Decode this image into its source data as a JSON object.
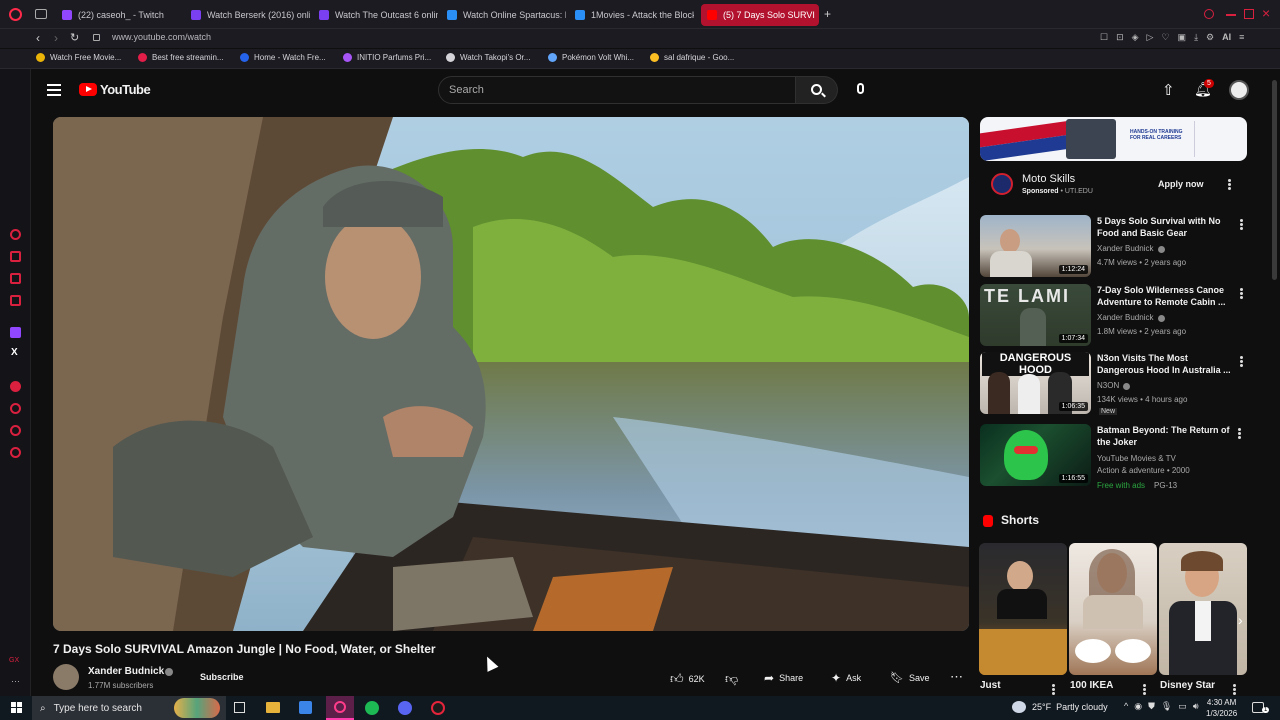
{
  "browser": {
    "tabs": [
      {
        "label": "(22) caseoh_ - Twitch",
        "color": "#9146ff"
      },
      {
        "label": "Watch Berserk (2016) onli",
        "color": "#7b3ff2"
      },
      {
        "label": "Watch The Outcast 6 onlin",
        "color": "#7b3ff2"
      },
      {
        "label": "Watch Online Spartacus: H",
        "color": "#2a8ff7"
      },
      {
        "label": "1Movies - Attack the Block",
        "color": "#2a8ff7"
      },
      {
        "label": "(5) 7 Days Solo SURVI",
        "color": "#ff0000"
      }
    ],
    "url": "www.youtube.com/watch",
    "bookmarks": [
      {
        "label": "Watch Free Movie...",
        "color": "#eab308"
      },
      {
        "label": "Best free streamin...",
        "color": "#e11d48"
      },
      {
        "label": "Home - Watch Fre...",
        "color": "#2563eb"
      },
      {
        "label": "INITIO Parfums Pri...",
        "color": "#a855f7"
      },
      {
        "label": "Watch Takopi's Or...",
        "color": "#d4d4d8"
      },
      {
        "label": "Pokémon Volt Whi...",
        "color": "#60a5fa"
      },
      {
        "label": "sal dafrique - Goo...",
        "color": "#fbbf24"
      }
    ],
    "ai_label": "AI"
  },
  "youtube": {
    "logo_text": "YouTube",
    "search_placeholder": "Search",
    "notification_count": "5",
    "video": {
      "title": "7 Days Solo SURVIVAL Amazon Jungle | No Food, Water, or Shelter",
      "channel": "Xander Budnick",
      "subscribers": "1.77M subscribers",
      "subscribe_label": "Subscribe",
      "likes": "62K",
      "share_label": "Share",
      "ask_label": "Ask",
      "save_label": "Save"
    },
    "ad": {
      "banner_text": "HANDS-ON TRAINING FOR REAL CAREERS",
      "title": "Moto Skills",
      "sponsored": "Sponsored",
      "domain": "UTI.EDU",
      "cta": "Apply now"
    },
    "recommendations": [
      {
        "title": "5 Days Solo Survival with No Food and Basic Gear",
        "channel": "Xander Budnick",
        "stats": "4.7M views • 2 years ago",
        "duration": "1:12:24",
        "verified": true
      },
      {
        "title": "7-Day Solo Wilderness Canoe Adventure to Remote Cabin ...",
        "channel": "Xander Budnick",
        "stats": "1.8M views • 2 years ago",
        "duration": "1:07:34",
        "verified": true
      },
      {
        "title": "N3on Visits The Most Dangerous Hood In Australia ...",
        "channel": "N3ON",
        "stats": "134K views • 4 hours ago",
        "badge": "New",
        "duration": "1:06:35",
        "verified": true
      },
      {
        "title": "Batman Beyond: The Return of the Joker",
        "channel": "YouTube Movies & TV",
        "stats": "Action & adventure • 2000",
        "free": "Free with ads",
        "rating": "PG-13",
        "duration": "1:16:55",
        "verified": false
      }
    ],
    "shorts_heading": "Shorts",
    "shorts": [
      {
        "label": "Just"
      },
      {
        "label": "100 IKEA"
      },
      {
        "label": "Disney Star"
      }
    ]
  },
  "taskbar": {
    "search_placeholder": "Type here to search",
    "weather": "25°F  Partly cloudy",
    "time": "4:30 AM",
    "date": "1/3/2026",
    "notification_count": "1"
  }
}
